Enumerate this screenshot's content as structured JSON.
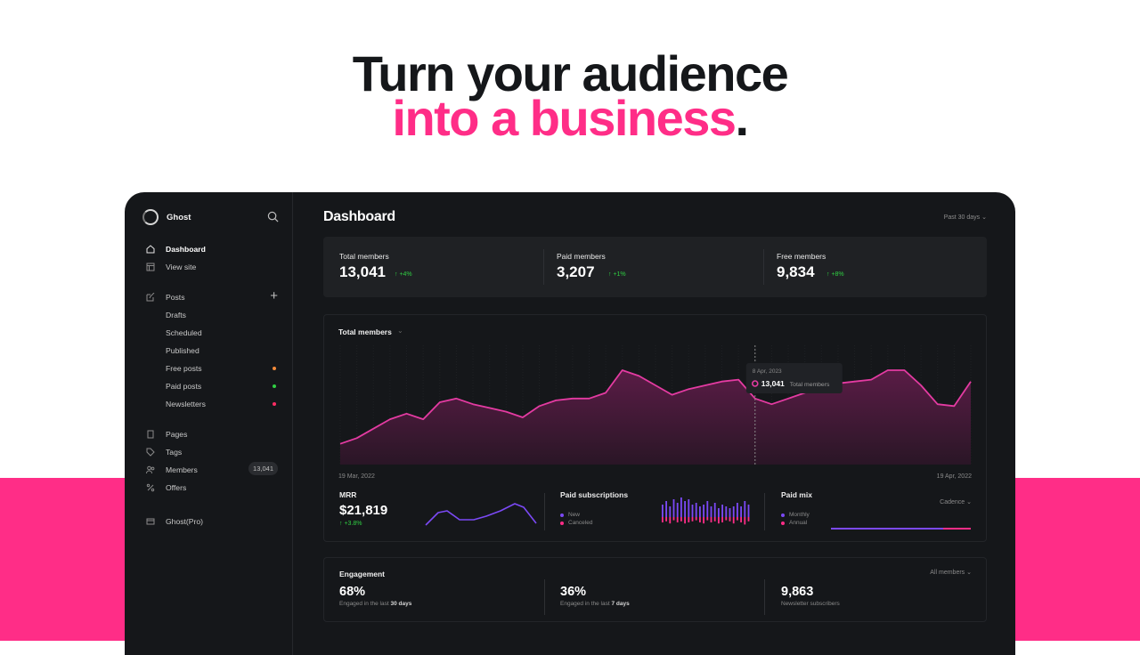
{
  "hero": {
    "line1": "Turn your audience",
    "line2": "into a business",
    "period": "."
  },
  "colors": {
    "accent": "#ff2d87",
    "positive": "#30cf43",
    "chart_line": "#e43ba2",
    "mrr_line": "#7b49f5"
  },
  "sidebar": {
    "brand": "Ghost",
    "items": [
      {
        "label": "Dashboard",
        "icon": "home-icon"
      },
      {
        "label": "View site",
        "icon": "layout-icon"
      },
      {
        "label": "Posts",
        "icon": "edit-icon"
      },
      {
        "label": "Drafts"
      },
      {
        "label": "Scheduled"
      },
      {
        "label": "Published"
      },
      {
        "label": "Free posts",
        "dot": "#f58b3a"
      },
      {
        "label": "Paid posts",
        "dot": "#30cf43"
      },
      {
        "label": "Newsletters",
        "dot": "#ff2d64"
      },
      {
        "label": "Pages",
        "icon": "page-icon"
      },
      {
        "label": "Tags",
        "icon": "tag-icon"
      },
      {
        "label": "Members",
        "icon": "members-icon",
        "badge": "13,041"
      },
      {
        "label": "Offers",
        "icon": "percent-icon"
      },
      {
        "label": "Ghost(Pro)",
        "icon": "card-icon"
      }
    ]
  },
  "header": {
    "title": "Dashboard",
    "range": "Past 30 days"
  },
  "stats": [
    {
      "label": "Total members",
      "value": "13,041",
      "change": "+4%"
    },
    {
      "label": "Paid members",
      "value": "3,207",
      "change": "+1%"
    },
    {
      "label": "Free members",
      "value": "9,834",
      "change": "+8%"
    }
  ],
  "members_card": {
    "title": "Total members",
    "start_date": "19 Mar, 2022",
    "end_date": "19 Apr, 2022"
  },
  "tooltip": {
    "date": "8 Apr, 2023",
    "value": "13,041",
    "label": "Total members"
  },
  "chart_data": {
    "type": "area",
    "title": "Total members",
    "x_range": [
      "19 Mar, 2022",
      "19 Apr, 2022"
    ],
    "values": [
      22,
      28,
      38,
      48,
      54,
      48,
      66,
      70,
      64,
      60,
      56,
      50,
      62,
      68,
      70,
      70,
      76,
      100,
      94,
      84,
      74,
      80,
      84,
      88,
      90,
      70,
      64,
      70,
      76,
      84,
      86,
      88,
      90,
      100,
      100,
      84,
      64,
      62,
      88
    ],
    "grid": true,
    "highlight_index": 25
  },
  "mrr": {
    "title": "MRR",
    "value": "$21,819",
    "change": "+3.8%"
  },
  "paid_subs": {
    "title": "Paid subscriptions",
    "legend": [
      "New",
      "Canceled"
    ]
  },
  "paid_mix": {
    "title": "Paid mix",
    "filter": "Cadence",
    "legend": [
      "Monthly",
      "Annual"
    ],
    "monthly_share": 0.8
  },
  "engagement": {
    "title": "Engagement",
    "filter": "All members",
    "metrics": [
      {
        "value": "68%",
        "prefix": "Engaged in the last",
        "bold": "30 days"
      },
      {
        "value": "36%",
        "prefix": "Engaged in the last",
        "bold": "7 days"
      },
      {
        "value": "9,863",
        "prefix": "Newsletter subscribers",
        "bold": ""
      }
    ]
  }
}
